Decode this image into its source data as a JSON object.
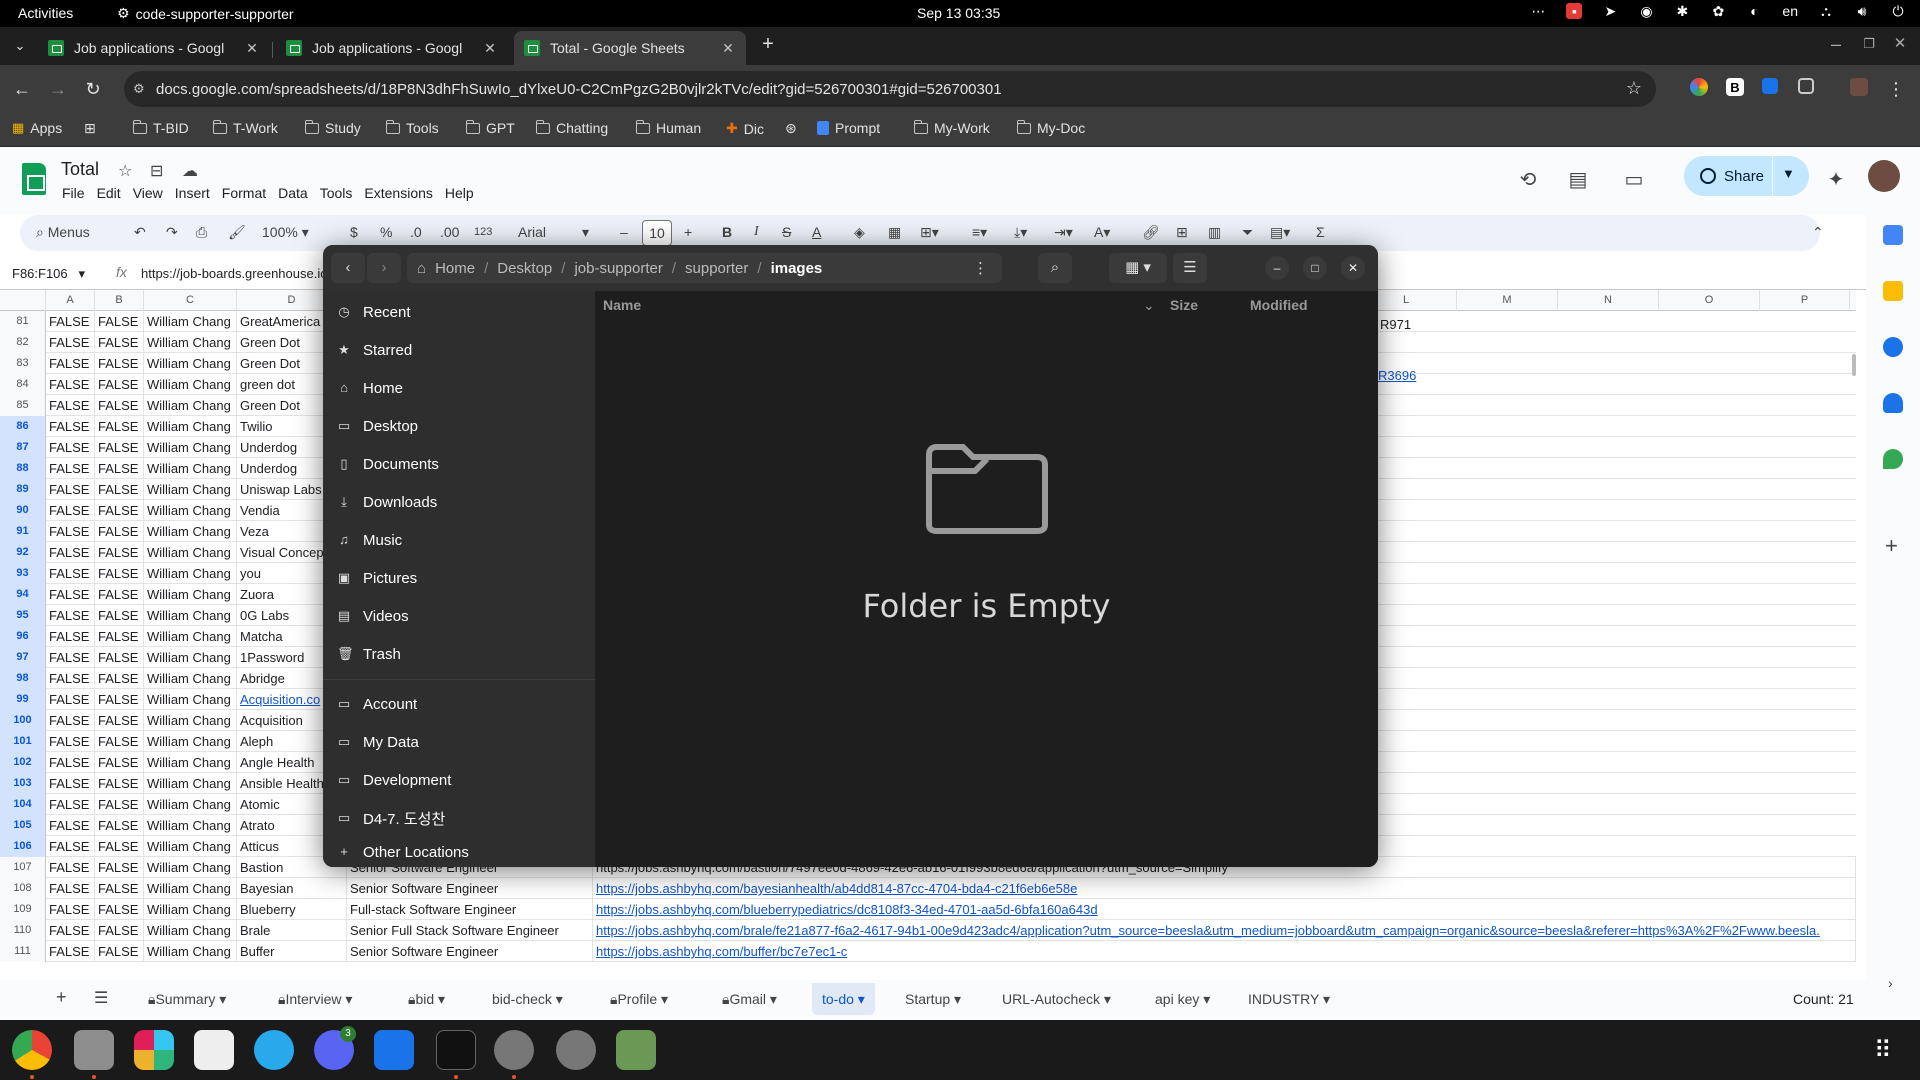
{
  "topbar": {
    "activities": "Activities",
    "app_name": "code-supporter-supporter",
    "clock": "Sep 13  03:35",
    "lang": "en"
  },
  "browser": {
    "tabs": [
      {
        "label": "Job applications - Googl",
        "active": false
      },
      {
        "label": "Job applications - Googl",
        "active": false
      },
      {
        "label": "Total - Google Sheets",
        "active": true
      }
    ],
    "url": "docs.google.com/spreadsheets/d/18P8N3dhFhSuwIo_dYlxeU0-C2CmPgzG2B0vjlr2kTVc/edit?gid=526700301#gid=526700301",
    "bookmarks": [
      "Apps",
      "T-BID",
      "T-Work",
      "Study",
      "Tools",
      "GPT",
      "Chatting",
      "Human",
      "Dic",
      "Prompt",
      "My-Work",
      "My-Doc"
    ]
  },
  "sheets": {
    "title": "Total",
    "menus": [
      "File",
      "Edit",
      "View",
      "Insert",
      "Format",
      "Data",
      "Tools",
      "Extensions",
      "Help"
    ],
    "share_label": "Share",
    "toolbar": {
      "search": "Menus",
      "zoom": "100%",
      "currency": "$",
      "percent": "%",
      "dec_down": ".0",
      "dec_up": ".00",
      "number_format": "123",
      "font": "Arial",
      "font_size": "10",
      "bold": "B",
      "italic": "I",
      "strike": "S",
      "text_color": "A"
    },
    "name_box": "F86:F106",
    "formula": "https://job-boards.greenhouse.io/",
    "columns": [
      "A",
      "B",
      "C",
      "D",
      "L",
      "M",
      "N",
      "O",
      "P"
    ],
    "rows": [
      {
        "n": "81",
        "a": "FALSE",
        "b": "FALSE",
        "c": "William Chang",
        "d": "GreatAmerica",
        "sel": false
      },
      {
        "n": "82",
        "a": "FALSE",
        "b": "FALSE",
        "c": "William Chang",
        "d": "Green Dot",
        "sel": false
      },
      {
        "n": "83",
        "a": "FALSE",
        "b": "FALSE",
        "c": "William Chang",
        "d": "Green Dot",
        "sel": false
      },
      {
        "n": "84",
        "a": "FALSE",
        "b": "FALSE",
        "c": "William Chang",
        "d": "green dot",
        "sel": false
      },
      {
        "n": "85",
        "a": "FALSE",
        "b": "FALSE",
        "c": "William Chang",
        "d": "Green Dot",
        "sel": false
      },
      {
        "n": "86",
        "a": "FALSE",
        "b": "FALSE",
        "c": "William Chang",
        "d": "Twilio",
        "sel": true
      },
      {
        "n": "87",
        "a": "FALSE",
        "b": "FALSE",
        "c": "William Chang",
        "d": "Underdog",
        "sel": true
      },
      {
        "n": "88",
        "a": "FALSE",
        "b": "FALSE",
        "c": "William Chang",
        "d": "Underdog",
        "sel": true
      },
      {
        "n": "89",
        "a": "FALSE",
        "b": "FALSE",
        "c": "William Chang",
        "d": "Uniswap Labs",
        "sel": true
      },
      {
        "n": "90",
        "a": "FALSE",
        "b": "FALSE",
        "c": "William Chang",
        "d": "Vendia",
        "sel": true
      },
      {
        "n": "91",
        "a": "FALSE",
        "b": "FALSE",
        "c": "William Chang",
        "d": "Veza",
        "sel": true
      },
      {
        "n": "92",
        "a": "FALSE",
        "b": "FALSE",
        "c": "William Chang",
        "d": "Visual Concep",
        "sel": true
      },
      {
        "n": "93",
        "a": "FALSE",
        "b": "FALSE",
        "c": "William Chang",
        "d": "you",
        "sel": true
      },
      {
        "n": "94",
        "a": "FALSE",
        "b": "FALSE",
        "c": "William Chang",
        "d": "Zuora",
        "sel": true
      },
      {
        "n": "95",
        "a": "FALSE",
        "b": "FALSE",
        "c": "William Chang",
        "d": "0G Labs",
        "sel": true
      },
      {
        "n": "96",
        "a": "FALSE",
        "b": "FALSE",
        "c": "William Chang",
        "d": "Matcha",
        "sel": true
      },
      {
        "n": "97",
        "a": "FALSE",
        "b": "FALSE",
        "c": "William Chang",
        "d": "1Password",
        "sel": true
      },
      {
        "n": "98",
        "a": "FALSE",
        "b": "FALSE",
        "c": "William Chang",
        "d": "Abridge",
        "sel": true
      },
      {
        "n": "99",
        "a": "FALSE",
        "b": "FALSE",
        "c": "William Chang",
        "d": "Acquisition.co",
        "sel": true
      },
      {
        "n": "100",
        "a": "FALSE",
        "b": "FALSE",
        "c": "William Chang",
        "d": "Acquisition",
        "sel": true
      },
      {
        "n": "101",
        "a": "FALSE",
        "b": "FALSE",
        "c": "William Chang",
        "d": "Aleph",
        "sel": true
      },
      {
        "n": "102",
        "a": "FALSE",
        "b": "FALSE",
        "c": "William Chang",
        "d": "Angle Health",
        "sel": true
      },
      {
        "n": "103",
        "a": "FALSE",
        "b": "FALSE",
        "c": "William Chang",
        "d": "Ansible Health",
        "sel": true
      },
      {
        "n": "104",
        "a": "FALSE",
        "b": "FALSE",
        "c": "William Chang",
        "d": "Atomic",
        "sel": true
      },
      {
        "n": "105",
        "a": "FALSE",
        "b": "FALSE",
        "c": "William Chang",
        "d": "Atrato",
        "sel": true
      },
      {
        "n": "106",
        "a": "FALSE",
        "b": "FALSE",
        "c": "William Chang",
        "d": "Atticus",
        "sel": true
      },
      {
        "n": "107",
        "a": "FALSE",
        "b": "FALSE",
        "c": "William Chang",
        "d": "Bastion",
        "e": "Senior Software Engineer",
        "f": "https://jobs.ashbyhq.com/bastion/7497ee0d-4869-42e6-ab16-01f993b8ed6a/application?utm_source=Simplify",
        "sel": false
      },
      {
        "n": "108",
        "a": "FALSE",
        "b": "FALSE",
        "c": "William Chang",
        "d": "Bayesian",
        "e": "Senior Software Engineer",
        "f": "https://jobs.ashbyhq.com/bayesianhealth/ab4dd814-87cc-4704-bda4-c21f6eb6e58e",
        "sel": false
      },
      {
        "n": "109",
        "a": "FALSE",
        "b": "FALSE",
        "c": "William Chang",
        "d": "Blueberry",
        "e": "Full-stack Software Engineer",
        "f": "https://jobs.ashbyhq.com/blueberrypediatrics/dc8108f3-34ed-4701-aa5d-6bfa160a643d",
        "sel": false
      },
      {
        "n": "110",
        "a": "FALSE",
        "b": "FALSE",
        "c": "William Chang",
        "d": "Brale",
        "e": "Senior Full Stack Software Engineer",
        "f": "https://jobs.ashbyhq.com/brale/fe21a877-f6a2-4617-94b1-00e9d423adc4/application?utm_source=beesla&utm_medium=jobboard&utm_campaign=organic&source=beesla&referer=https%3A%2F%2Fwww.beesla.",
        "sel": false
      },
      {
        "n": "111",
        "a": "FALSE",
        "b": "FALSE",
        "c": "William Chang",
        "d": "Buffer",
        "e": "Senior Software Engineer",
        "f": "https://jobs.ashbyhq.com/buffer/bc7e7ec1-c",
        "sel": false
      }
    ],
    "extra_cells": {
      "l81": "R971",
      "l84": "R3696"
    },
    "sheet_tabs": [
      {
        "label": "Summary",
        "locked": true
      },
      {
        "label": "Interview",
        "locked": true
      },
      {
        "label": "bid",
        "locked": true
      },
      {
        "label": "bid-check",
        "locked": false
      },
      {
        "label": "Profile",
        "locked": true
      },
      {
        "label": "Gmail",
        "locked": true
      },
      {
        "label": "to-do",
        "locked": false,
        "active": true
      },
      {
        "label": "Startup",
        "locked": false
      },
      {
        "label": "URL-Autocheck",
        "locked": false
      },
      {
        "label": "api key",
        "locked": false
      },
      {
        "label": "INDUSTRY",
        "locked": false
      }
    ],
    "count": "Count: 21"
  },
  "files": {
    "path": [
      "Home",
      "Desktop",
      "job-supporter",
      "supporter",
      "images"
    ],
    "sidebar": [
      {
        "label": "Recent",
        "icon": "clock-icon"
      },
      {
        "label": "Starred",
        "icon": "star-icon"
      },
      {
        "label": "Home",
        "icon": "home-icon"
      },
      {
        "label": "Desktop",
        "icon": "desktop-icon"
      },
      {
        "label": "Documents",
        "icon": "documents-icon"
      },
      {
        "label": "Downloads",
        "icon": "download-icon"
      },
      {
        "label": "Music",
        "icon": "music-icon"
      },
      {
        "label": "Pictures",
        "icon": "pictures-icon"
      },
      {
        "label": "Videos",
        "icon": "videos-icon"
      },
      {
        "label": "Trash",
        "icon": "trash-icon"
      }
    ],
    "bookmarks": [
      "Account",
      "My Data",
      "Development",
      "D4-7. 도성찬"
    ],
    "other_locations": "Other Locations",
    "columns": {
      "name": "Name",
      "size": "Size",
      "modified": "Modified"
    },
    "empty_text": "Folder is Empty"
  }
}
